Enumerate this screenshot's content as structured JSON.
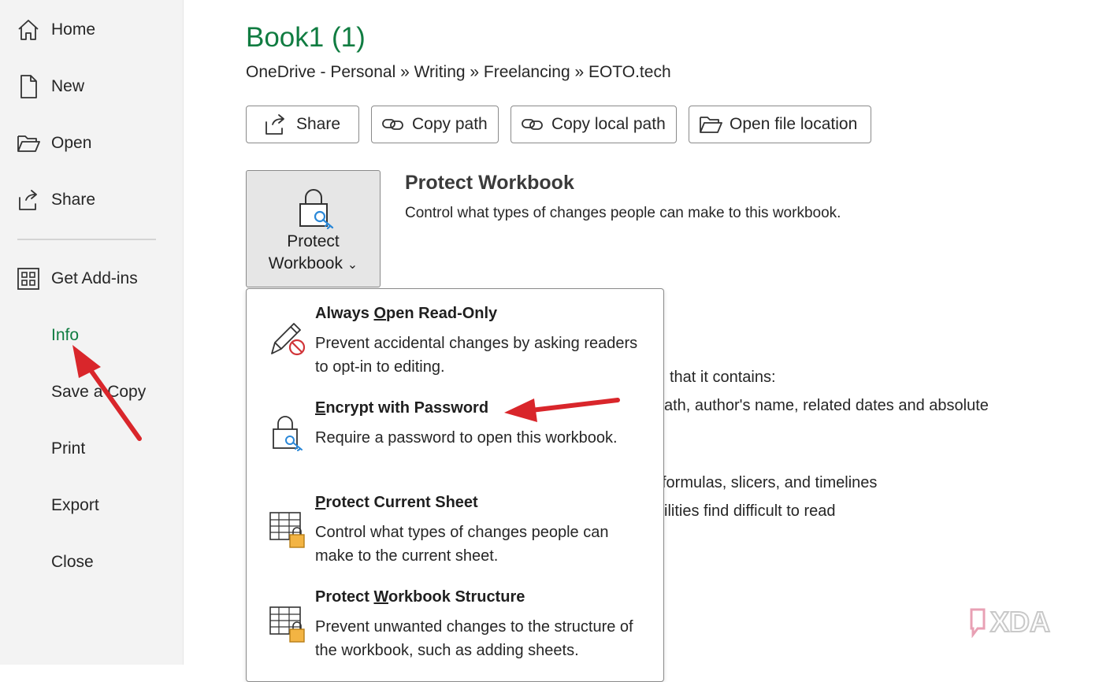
{
  "sidebar": {
    "items": [
      {
        "label": "Home",
        "icon": "home-icon"
      },
      {
        "label": "New",
        "icon": "new-document-icon"
      },
      {
        "label": "Open",
        "icon": "open-folder-icon"
      },
      {
        "label": "Share",
        "icon": "share-icon"
      },
      {
        "label": "Get Add-ins",
        "icon": "add-ins-grid-icon"
      },
      {
        "label": "Info",
        "active": true
      },
      {
        "label": "Save a Copy"
      },
      {
        "label": "Print"
      },
      {
        "label": "Export"
      },
      {
        "label": "Close"
      }
    ],
    "active_color": "#107c41"
  },
  "main": {
    "title": "Book1 (1)",
    "breadcrumb": "OneDrive - Personal » Writing » Freelancing » EOTO.tech",
    "actions": [
      {
        "label": "Share",
        "icon": "share-icon"
      },
      {
        "label": "Copy path",
        "icon": "link-icon"
      },
      {
        "label": "Copy local path",
        "icon": "link-icon"
      },
      {
        "label": "Open file location",
        "icon": "open-folder-icon"
      }
    ],
    "protect": {
      "tile_line1": "Protect",
      "tile_line2": "Workbook",
      "chevron": "⌄",
      "title": "Protect Workbook",
      "description": "Control what types of changes people can make to this workbook."
    },
    "background_lines": [
      "that it contains:",
      "ath, author's name, related dates and absolute",
      "formulas, slicers, and timelines",
      "ilities find difficult to read"
    ]
  },
  "dropdown": {
    "items": [
      {
        "title": "Always Open Read-Only",
        "description": "Prevent accidental changes by asking readers to opt-in to editing.",
        "icon": "pencil-no-edit-icon"
      },
      {
        "title": "Encrypt with Password",
        "description": "Require a password to open this workbook.",
        "icon": "lock-key-icon"
      },
      {
        "title": "Protect Current Sheet",
        "description": "Control what types of changes people can make to the current sheet.",
        "icon": "sheet-lock-icon"
      },
      {
        "title": "Protect Workbook Structure",
        "description": "Prevent unwanted changes to the structure of the workbook, such as adding sheets.",
        "icon": "workbook-lock-icon"
      }
    ]
  },
  "annotation_color": "#d9262b",
  "watermark": "XDA"
}
